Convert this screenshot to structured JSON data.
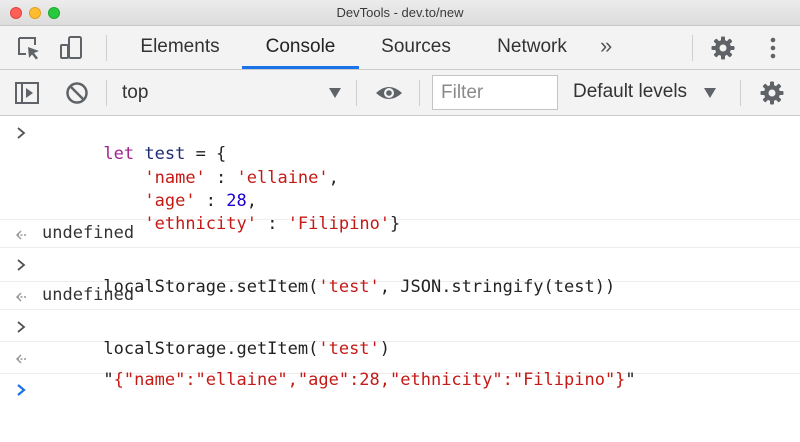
{
  "window": {
    "title": "DevTools - dev.to/new"
  },
  "tabs": [
    {
      "label": "Elements",
      "active": false
    },
    {
      "label": "Console",
      "active": true
    },
    {
      "label": "Sources",
      "active": false
    },
    {
      "label": "Network",
      "active": false
    }
  ],
  "more_tabs": "»",
  "toolbar": {
    "context": "top",
    "filter_placeholder": "Filter",
    "levels": "Default levels"
  },
  "console": {
    "entries": [
      {
        "type": "input",
        "lines": [
          {
            "tokens": [
              {
                "t": "let ",
                "c": "kw"
              },
              {
                "t": "test",
                "c": "var"
              },
              {
                "t": " = {",
                "c": "punct"
              }
            ]
          },
          {
            "tokens": [
              {
                "t": "    ",
                "c": "punct"
              },
              {
                "t": "'name'",
                "c": "str"
              },
              {
                "t": " : ",
                "c": "punct"
              },
              {
                "t": "'ellaine'",
                "c": "str"
              },
              {
                "t": ",",
                "c": "punct"
              }
            ]
          },
          {
            "tokens": [
              {
                "t": "    ",
                "c": "punct"
              },
              {
                "t": "'age'",
                "c": "str"
              },
              {
                "t": " : ",
                "c": "punct"
              },
              {
                "t": "28",
                "c": "num"
              },
              {
                "t": ",",
                "c": "punct"
              }
            ]
          },
          {
            "tokens": [
              {
                "t": "    ",
                "c": "punct"
              },
              {
                "t": "'ethnicity'",
                "c": "str"
              },
              {
                "t": " : ",
                "c": "punct"
              },
              {
                "t": "'Filipino'",
                "c": "str"
              },
              {
                "t": "}",
                "c": "punct"
              }
            ]
          }
        ]
      },
      {
        "type": "output",
        "text": "undefined"
      },
      {
        "type": "input",
        "lines": [
          {
            "tokens": [
              {
                "t": "localStorage.setItem(",
                "c": "punct"
              },
              {
                "t": "'test'",
                "c": "str"
              },
              {
                "t": ", JSON.stringify(test))",
                "c": "punct"
              }
            ]
          }
        ]
      },
      {
        "type": "output",
        "text": "undefined"
      },
      {
        "type": "input",
        "lines": [
          {
            "tokens": [
              {
                "t": "localStorage.getItem(",
                "c": "punct"
              },
              {
                "t": "'test'",
                "c": "str"
              },
              {
                "t": ")",
                "c": "punct"
              }
            ]
          }
        ]
      },
      {
        "type": "output-string",
        "tokens": [
          {
            "t": "\"",
            "c": "punct"
          },
          {
            "t": "{\"name\":\"ellaine\",\"age\":28,\"ethnicity\":\"Filipino\"}",
            "c": "result-str"
          },
          {
            "t": "\"",
            "c": "punct"
          }
        ]
      }
    ]
  },
  "icons": {
    "inspect": "inspect-element-icon",
    "device": "device-toolbar-icon",
    "settings": "gear-icon",
    "menu": "kebab-menu-icon",
    "sidebar": "show-sidebar-icon",
    "clear": "clear-console-icon",
    "live": "eye-icon"
  },
  "colors": {
    "accent": "#1a73e8",
    "keyword": "#a2248f",
    "string": "#c41a16",
    "number": "#1c00cf"
  }
}
